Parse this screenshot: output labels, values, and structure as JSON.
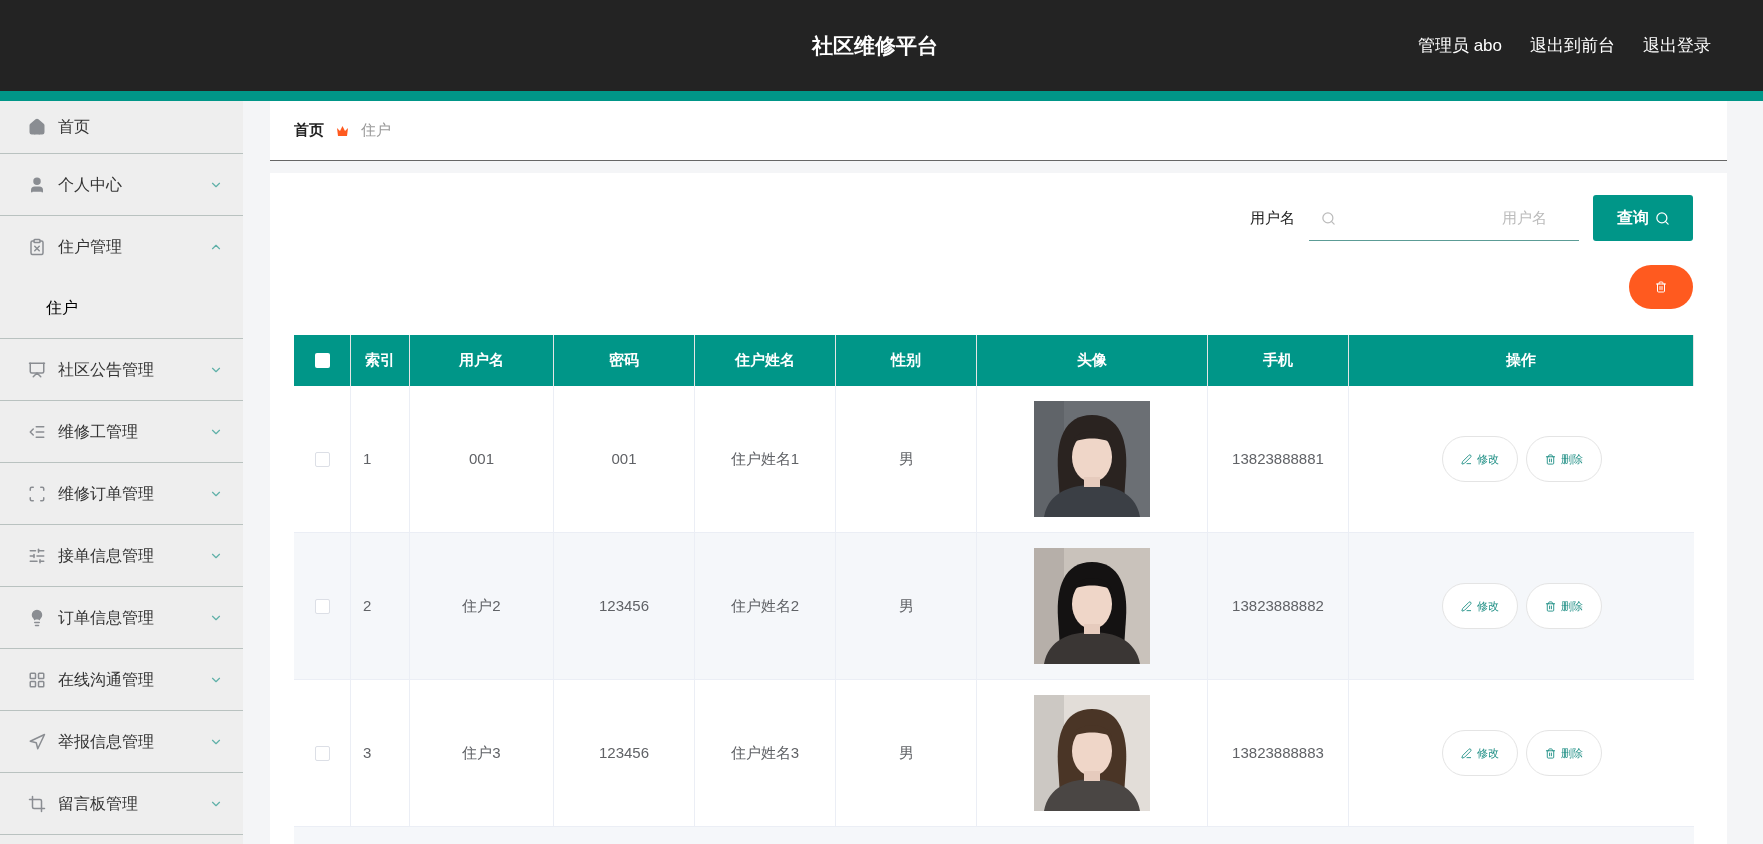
{
  "header": {
    "title": "社区维修平台",
    "links": [
      "管理员 abo",
      "退出到前台",
      "退出登录"
    ]
  },
  "sidebar": {
    "items": [
      {
        "kind": "link",
        "label": "首页"
      },
      {
        "kind": "menu",
        "label": "个人中心",
        "expanded": false
      },
      {
        "kind": "menu",
        "label": "住户管理",
        "expanded": true,
        "children": [
          {
            "label": "住户"
          }
        ]
      },
      {
        "kind": "menu",
        "label": "社区公告管理",
        "expanded": false
      },
      {
        "kind": "menu",
        "label": "维修工管理",
        "expanded": false
      },
      {
        "kind": "menu",
        "label": "维修订单管理",
        "expanded": false
      },
      {
        "kind": "menu",
        "label": "接单信息管理",
        "expanded": false
      },
      {
        "kind": "menu",
        "label": "订单信息管理",
        "expanded": false
      },
      {
        "kind": "menu",
        "label": "在线沟通管理",
        "expanded": false
      },
      {
        "kind": "menu",
        "label": "举报信息管理",
        "expanded": false
      },
      {
        "kind": "menu",
        "label": "留言板管理",
        "expanded": false
      }
    ]
  },
  "breadcrumb": [
    "首页",
    "住户"
  ],
  "search": {
    "label": "用户名",
    "placeholder": "用户名",
    "button": "查询"
  },
  "table": {
    "all_checked": false,
    "columns": [
      "索引",
      "用户名",
      "密码",
      "住户姓名",
      "性别",
      "头像",
      "手机",
      "操作"
    ],
    "rows": [
      {
        "checked": false,
        "cells": [
          "1",
          "001",
          "001",
          "住户姓名1",
          "男"
        ],
        "avatar": {
          "kind": "picture"
        },
        "phone": "13823888881",
        "actions": [
          "修改",
          "删除"
        ]
      },
      {
        "checked": false,
        "cells": [
          "2",
          "住户2",
          "123456",
          "住户姓名2",
          "男"
        ],
        "avatar": {
          "kind": "picture"
        },
        "phone": "13823888882",
        "actions": [
          "修改",
          "删除"
        ]
      },
      {
        "checked": false,
        "cells": [
          "3",
          "住户3",
          "123456",
          "住户姓名3",
          "男"
        ],
        "avatar": {
          "kind": "picture"
        },
        "phone": "13823888883",
        "actions": [
          "修改",
          "删除"
        ]
      }
    ]
  }
}
